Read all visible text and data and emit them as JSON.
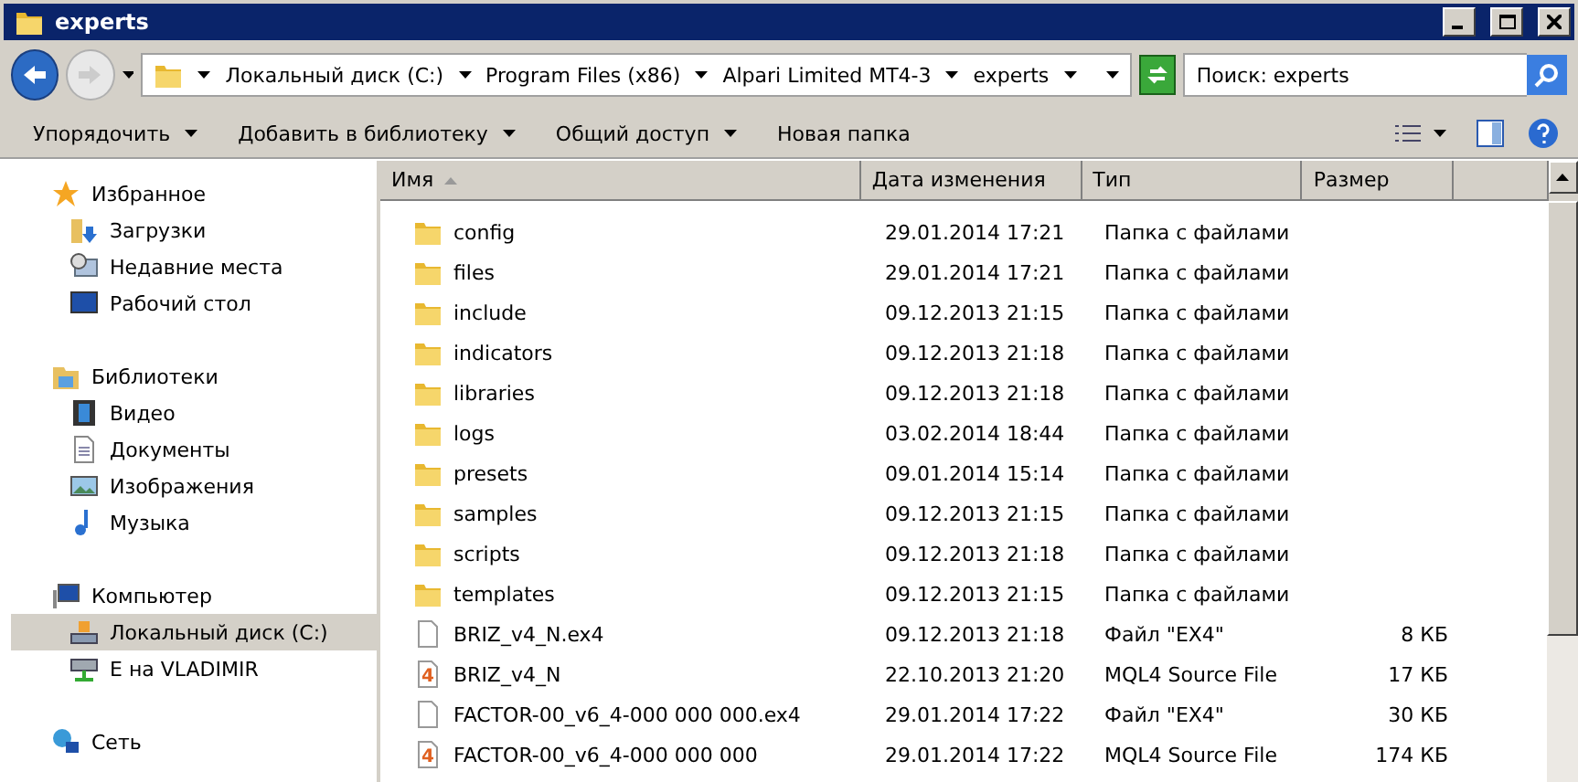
{
  "window": {
    "title": "experts"
  },
  "breadcrumb": [
    "Локальный диск (C:)",
    "Program Files (x86)",
    "Alpari Limited MT4-3",
    "experts"
  ],
  "search": {
    "placeholder": "Поиск: experts"
  },
  "toolbar": [
    {
      "label": "Упорядочить",
      "dropdown": true
    },
    {
      "label": "Добавить в библиотеку",
      "dropdown": true
    },
    {
      "label": "Общий доступ",
      "dropdown": true
    },
    {
      "label": "Новая папка",
      "dropdown": false
    }
  ],
  "sidebar": [
    {
      "label": "Избранное",
      "kind": "star",
      "children": [
        {
          "label": "Загрузки",
          "kind": "downloads",
          "selected": false
        },
        {
          "label": "Недавние места",
          "kind": "recent",
          "selected": false
        },
        {
          "label": "Рабочий стол",
          "kind": "desktop",
          "selected": false
        }
      ]
    },
    {
      "label": "Библиотеки",
      "kind": "library",
      "children": [
        {
          "label": "Видео",
          "kind": "video",
          "selected": false
        },
        {
          "label": "Документы",
          "kind": "document",
          "selected": false
        },
        {
          "label": "Изображения",
          "kind": "image",
          "selected": false
        },
        {
          "label": "Музыка",
          "kind": "music",
          "selected": false
        }
      ]
    },
    {
      "label": "Компьютер",
      "kind": "computer",
      "children": [
        {
          "label": "Локальный диск (C:)",
          "kind": "disk",
          "selected": true
        },
        {
          "label": "E на VLADIMIR",
          "kind": "netdrive",
          "selected": false
        }
      ]
    },
    {
      "label": "Сеть",
      "kind": "network"
    }
  ],
  "table": {
    "columns": [
      "Имя",
      "Дата изменения",
      "Тип",
      "Размер"
    ],
    "rows": [
      {
        "kind": "folder",
        "name": "config",
        "date": "29.01.2014 17:21",
        "type": "Папка с файлами"
      },
      {
        "kind": "folder",
        "name": "files",
        "date": "29.01.2014 17:21",
        "type": "Папка с файлами"
      },
      {
        "kind": "folder",
        "name": "include",
        "date": "09.12.2013 21:15",
        "type": "Папка с файлами"
      },
      {
        "kind": "folder",
        "name": "indicators",
        "date": "09.12.2013 21:18",
        "type": "Папка с файлами"
      },
      {
        "kind": "folder",
        "name": "libraries",
        "date": "09.12.2013 21:18",
        "type": "Папка с файлами"
      },
      {
        "kind": "folder",
        "name": "logs",
        "date": "03.02.2014 18:44",
        "type": "Папка с файлами"
      },
      {
        "kind": "folder",
        "name": "presets",
        "date": "09.01.2014 15:14",
        "type": "Папка с файлами"
      },
      {
        "kind": "folder",
        "name": "samples",
        "date": "09.12.2013 21:15",
        "type": "Папка с файлами"
      },
      {
        "kind": "folder",
        "name": "scripts",
        "date": "09.12.2013 21:18",
        "type": "Папка с файлами"
      },
      {
        "kind": "folder",
        "name": "templates",
        "date": "09.12.2013 21:15",
        "type": "Папка с файлами"
      },
      {
        "kind": "file",
        "name": "BRIZ_v4_N.ex4",
        "date": "09.12.2013 21:18",
        "type": "Файл \"EX4\"",
        "size": "8 КБ"
      },
      {
        "kind": "mql",
        "name": "BRIZ_v4_N",
        "date": "22.10.2013 21:20",
        "type": "MQL4 Source File",
        "size": "17 КБ",
        "badge": "4"
      },
      {
        "kind": "file",
        "name": "FACTOR-00_v6_4-000 000 000.ex4",
        "date": "29.01.2014 17:22",
        "type": "Файл \"EX4\"",
        "size": "30 КБ"
      },
      {
        "kind": "mql",
        "name": "FACTOR-00_v6_4-000 000 000",
        "date": "29.01.2014 17:22",
        "type": "MQL4 Source File",
        "size": "174 КБ",
        "badge": "4"
      }
    ]
  }
}
